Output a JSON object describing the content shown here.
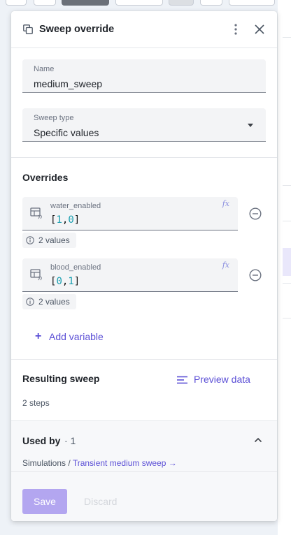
{
  "panel": {
    "title": "Sweep override",
    "icons": {
      "title": "copy-icon",
      "menu": "more-vertical-icon",
      "close": "close-icon"
    }
  },
  "name_field": {
    "label": "Name",
    "value": "medium_sweep"
  },
  "sweep_type": {
    "label": "Sweep type",
    "value": "Specific values"
  },
  "overrides": {
    "title": "Overrides",
    "items": [
      {
        "label": "water_enabled",
        "values": [
          "1",
          "0"
        ],
        "count_text": "2 values"
      },
      {
        "label": "blood_enabled",
        "values": [
          "0",
          "1"
        ],
        "count_text": "2 values"
      }
    ],
    "add_label": "Add variable",
    "fx_label": "fx"
  },
  "resulting": {
    "title": "Resulting sweep",
    "preview_label": "Preview data",
    "steps_text": "2 steps"
  },
  "used_by": {
    "title": "Used by",
    "count": "· 1",
    "crumb_prefix": "Simulations / ",
    "link_label": "Transient medium sweep →"
  },
  "footer": {
    "save_label": "Save",
    "discard_label": "Discard"
  },
  "colors": {
    "accent": "#5b4fd6",
    "save_disabled": "#b3a6f0",
    "number": "#1a9fb0"
  }
}
